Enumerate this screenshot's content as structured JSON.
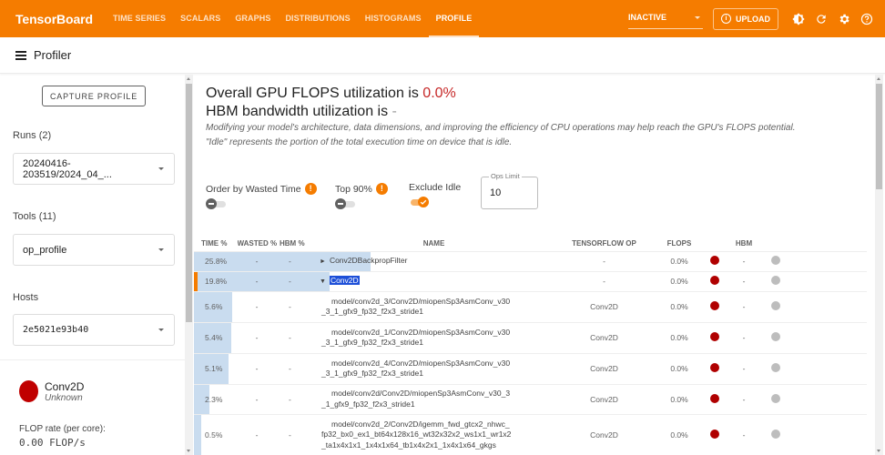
{
  "topbar": {
    "brand": "TensorBoard",
    "tabs": [
      {
        "label": "TIME SERIES",
        "active": false
      },
      {
        "label": "SCALARS",
        "active": false
      },
      {
        "label": "GRAPHS",
        "active": false
      },
      {
        "label": "DISTRIBUTIONS",
        "active": false
      },
      {
        "label": "HISTOGRAMS",
        "active": false
      },
      {
        "label": "PROFILE",
        "active": true
      }
    ],
    "status_select": "INACTIVE",
    "upload_label": "UPLOAD",
    "icons": [
      "theme-toggle-icon",
      "refresh-icon",
      "settings-icon",
      "help-icon"
    ]
  },
  "subheader": {
    "title": "Profiler"
  },
  "sidebar": {
    "capture_label": "CAPTURE PROFILE",
    "runs_label": "Runs (2)",
    "runs_value": "20240416-203519/2024_04_...",
    "tools_label": "Tools (11)",
    "tools_value": "op_profile",
    "hosts_label": "Hosts",
    "hosts_value": "2e5021e93b40",
    "selected_op": {
      "name": "Conv2D",
      "category": "Unknown",
      "flop_rate_label": "FLOP rate (per core):",
      "flop_rate_value": "0.00 FLOP/s",
      "color": "#c00000"
    }
  },
  "main": {
    "flops_line_prefix": "Overall GPU FLOPS utilization is ",
    "flops_value": "0.0%",
    "hbm_line_prefix": "HBM bandwidth utilization is ",
    "hbm_value": "-",
    "hint_1": "Modifying your model's architecture, data dimensions, and improving the efficiency of CPU operations may help reach the GPU's FLOPS potential.",
    "hint_2": "\"Idle\" represents the portion of the total execution time on device that is idle.",
    "controls": {
      "order_by_wasted": {
        "label": "Order by Wasted Time",
        "on": false
      },
      "top90": {
        "label": "Top 90%",
        "on": false
      },
      "exclude_idle": {
        "label": "Exclude Idle",
        "on": true
      },
      "ops_limit_label": "Ops Limit",
      "ops_limit_value": "10"
    },
    "table": {
      "headers": [
        "TIME %",
        "WASTED %",
        "HBM %",
        "NAME",
        "TENSORFLOW OP",
        "FLOPS",
        "HBM"
      ],
      "rows": [
        {
          "time": "25.8%",
          "time_frac": 0.258,
          "wasted": "-",
          "hbm_pct": "-",
          "name": "Conv2DBackpropFilter",
          "expander": "►",
          "level": 0,
          "tf_op": "-",
          "flops": "0.0%",
          "hbm": "-",
          "selected": false,
          "highlight": false
        },
        {
          "time": "19.8%",
          "time_frac": 0.198,
          "wasted": "-",
          "hbm_pct": "-",
          "name": "Conv2D",
          "expander": "▼",
          "level": 0,
          "tf_op": "-",
          "flops": "0.0%",
          "hbm": "-",
          "selected": true,
          "highlight": true
        },
        {
          "time": "5.6%",
          "time_frac": 0.056,
          "wasted": "-",
          "hbm_pct": "-",
          "name_lines": [
            "model/conv2d_3/Conv2D/miopenSp3AsmConv_v30",
            "_3_1_gfx9_fp32_f2x3_stride1"
          ],
          "level": 1,
          "tf_op": "Conv2D",
          "flops": "0.0%",
          "hbm": "-"
        },
        {
          "time": "5.4%",
          "time_frac": 0.054,
          "wasted": "-",
          "hbm_pct": "-",
          "name_lines": [
            "model/conv2d_1/Conv2D/miopenSp3AsmConv_v30",
            "_3_1_gfx9_fp32_f2x3_stride1"
          ],
          "level": 1,
          "tf_op": "Conv2D",
          "flops": "0.0%",
          "hbm": "-"
        },
        {
          "time": "5.1%",
          "time_frac": 0.051,
          "wasted": "-",
          "hbm_pct": "-",
          "name_lines": [
            "model/conv2d_4/Conv2D/miopenSp3AsmConv_v30",
            "_3_1_gfx9_fp32_f2x3_stride1"
          ],
          "level": 1,
          "tf_op": "Conv2D",
          "flops": "0.0%",
          "hbm": "-"
        },
        {
          "time": "2.3%",
          "time_frac": 0.023,
          "wasted": "-",
          "hbm_pct": "-",
          "name_lines": [
            "model/conv2d/Conv2D/miopenSp3AsmConv_v30_3",
            "_1_gfx9_fp32_f2x3_stride1"
          ],
          "level": 1,
          "tf_op": "Conv2D",
          "flops": "0.0%",
          "hbm": "-"
        },
        {
          "time": "0.5%",
          "time_frac": 0.005,
          "wasted": "-",
          "hbm_pct": "-",
          "name_lines": [
            "model/conv2d_2/Conv2D/igemm_fwd_gtcx2_nhwc_",
            "fp32_bx0_ex1_bt64x128x16_wt32x32x2_ws1x1_wr1x2",
            "_ta1x4x1x1_1x4x1x64_tb1x4x2x1_1x4x1x64_gkgs"
          ],
          "level": 1,
          "tf_op": "Conv2D",
          "flops": "0.0%",
          "hbm": "-"
        }
      ]
    }
  },
  "colors": {
    "accent": "#f57c00",
    "flops_dot": "#b00000",
    "hbm_dot": "#bdbdbd",
    "bar": "#c9dcef"
  }
}
